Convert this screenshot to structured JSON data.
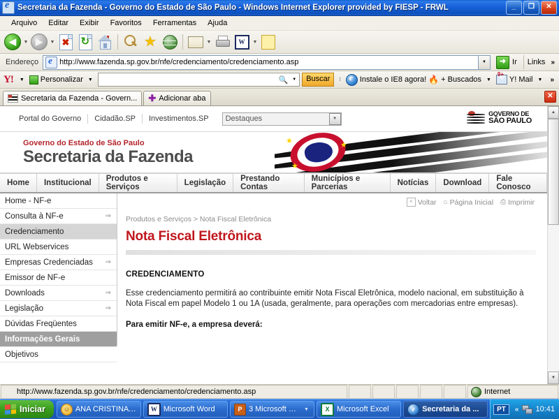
{
  "window": {
    "title": "Secretaria da Fazenda - Governo do Estado de São Paulo - Windows Internet Explorer provided by FIESP - FRWL",
    "minimize": "_",
    "maximize": "❐",
    "close": "✕"
  },
  "menu": {
    "items": [
      "Arquivo",
      "Editar",
      "Exibir",
      "Favoritos",
      "Ferramentas",
      "Ajuda"
    ]
  },
  "toolbar": {
    "back": "back-arrow",
    "forward": "forward-arrow",
    "stop": "stop-icon",
    "refresh": "refresh-icon",
    "home": "home-icon",
    "search": "search-icon",
    "favorites": "favorites-star-icon",
    "history": "history-icon",
    "mail": "mail-icon",
    "print": "print-icon",
    "edit_word": "word-edit-icon",
    "notes": "notes-icon",
    "dropdown_caret": "▼"
  },
  "address": {
    "label": "Endereço",
    "url": "http://www.fazenda.sp.gov.br/nfe/credenciamento/credenciamento.asp",
    "go_label": "Ir",
    "go_arrow": "➜",
    "links_label": "Links",
    "chevron": "»",
    "dropdown_caret": "▼"
  },
  "yahoo_bar": {
    "logo": "Y!",
    "personalizar": "Personalizar",
    "search_value": "",
    "search_placeholder": "",
    "buscar": "Buscar",
    "ie8": "Instale o IE8 agora!",
    "buscados": "+ Buscados",
    "ymail": "Y! Mail",
    "mail_badge": "9+",
    "chevron": "»",
    "caret": "▼"
  },
  "tabs": {
    "items": [
      {
        "label": "Secretaria da Fazenda - Govern...",
        "active": true
      },
      {
        "label": "Adicionar aba",
        "active": false
      }
    ],
    "close_label": "✕"
  },
  "gov_bar": {
    "links": [
      "Portal do Governo",
      "Cidadão.SP",
      "Investimentos.SP"
    ],
    "select_value": "Destaques",
    "select_caret": "▼",
    "logo_line1": "GOVERNO DE",
    "logo_line2": "SÃO PAULO"
  },
  "banner": {
    "line1": "Governo do Estado de São Paulo",
    "line2": "Secretaria da Fazenda"
  },
  "main_nav": {
    "items": [
      "Home",
      "Institucional",
      "Produtos e Serviços",
      "Legislação",
      "Prestando Contas",
      "Municípios e Parcerias",
      "Notícias",
      "Download",
      "Fale Conosco"
    ]
  },
  "sidebar": {
    "items": [
      {
        "label": "Home - NF-e",
        "arrow": false,
        "state": "normal"
      },
      {
        "label": "Consulta à NF-e",
        "arrow": true,
        "state": "normal"
      },
      {
        "label": "Credenciamento",
        "arrow": false,
        "state": "selected"
      },
      {
        "label": "URL Webservices",
        "arrow": false,
        "state": "normal"
      },
      {
        "label": "Empresas Credenciadas",
        "arrow": true,
        "state": "normal"
      },
      {
        "label": "Emissor de NF-e",
        "arrow": false,
        "state": "normal"
      },
      {
        "label": "Downloads",
        "arrow": true,
        "state": "normal"
      },
      {
        "label": "Legislação",
        "arrow": true,
        "state": "normal"
      },
      {
        "label": "Dúvidas Freqüentes",
        "arrow": false,
        "state": "normal"
      },
      {
        "label": "Informações Gerais",
        "arrow": false,
        "state": "header"
      },
      {
        "label": "Objetivos",
        "arrow": false,
        "state": "normal"
      }
    ],
    "arrow_glyph": "⇒"
  },
  "content": {
    "top_links": {
      "voltar": "Voltar",
      "pagina_inicial": "Página Inicial",
      "imprimir": "Imprimir",
      "back_glyph": "«"
    },
    "breadcrumb": "Produtos e Serviços > Nota Fiscal Eletrônica",
    "title": "Nota Fiscal Eletrônica",
    "section_heading": "CREDENCIAMENTO",
    "paragraph": "Esse credenciamento permitirá ao contribuinte emitir Nota Fiscal Eletrônica, modelo nacional, em substituição à Nota Fiscal em papel Modelo 1 ou 1A (usada, geralmente, para operações com mercadorias entre empresas).",
    "sub_heading": "Para emitir NF-e, a empresa deverá:",
    "title_color": "#c0161d"
  },
  "status_bar": {
    "url": "http://www.fazenda.sp.gov.br/nfe/credenciamento/credenciamento.asp",
    "zone": "Internet"
  },
  "taskbar": {
    "start": "Iniciar",
    "items": [
      {
        "label": "ANA CRISTINA F...",
        "icon": "contact-icon",
        "active": false,
        "dropdown": false
      },
      {
        "label": "Microsoft Word",
        "icon": "word-icon",
        "active": false,
        "dropdown": false
      },
      {
        "label": "3 Microsoft Po...",
        "icon": "powerpoint-icon",
        "active": false,
        "dropdown": true
      },
      {
        "label": "Microsoft Excel",
        "icon": "excel-icon",
        "active": false,
        "dropdown": false
      },
      {
        "label": "Secretaria da ...",
        "icon": "ie-icon",
        "active": true,
        "dropdown": false
      }
    ],
    "language": "PT",
    "tray_chevron": "«",
    "clock": "10:41"
  }
}
